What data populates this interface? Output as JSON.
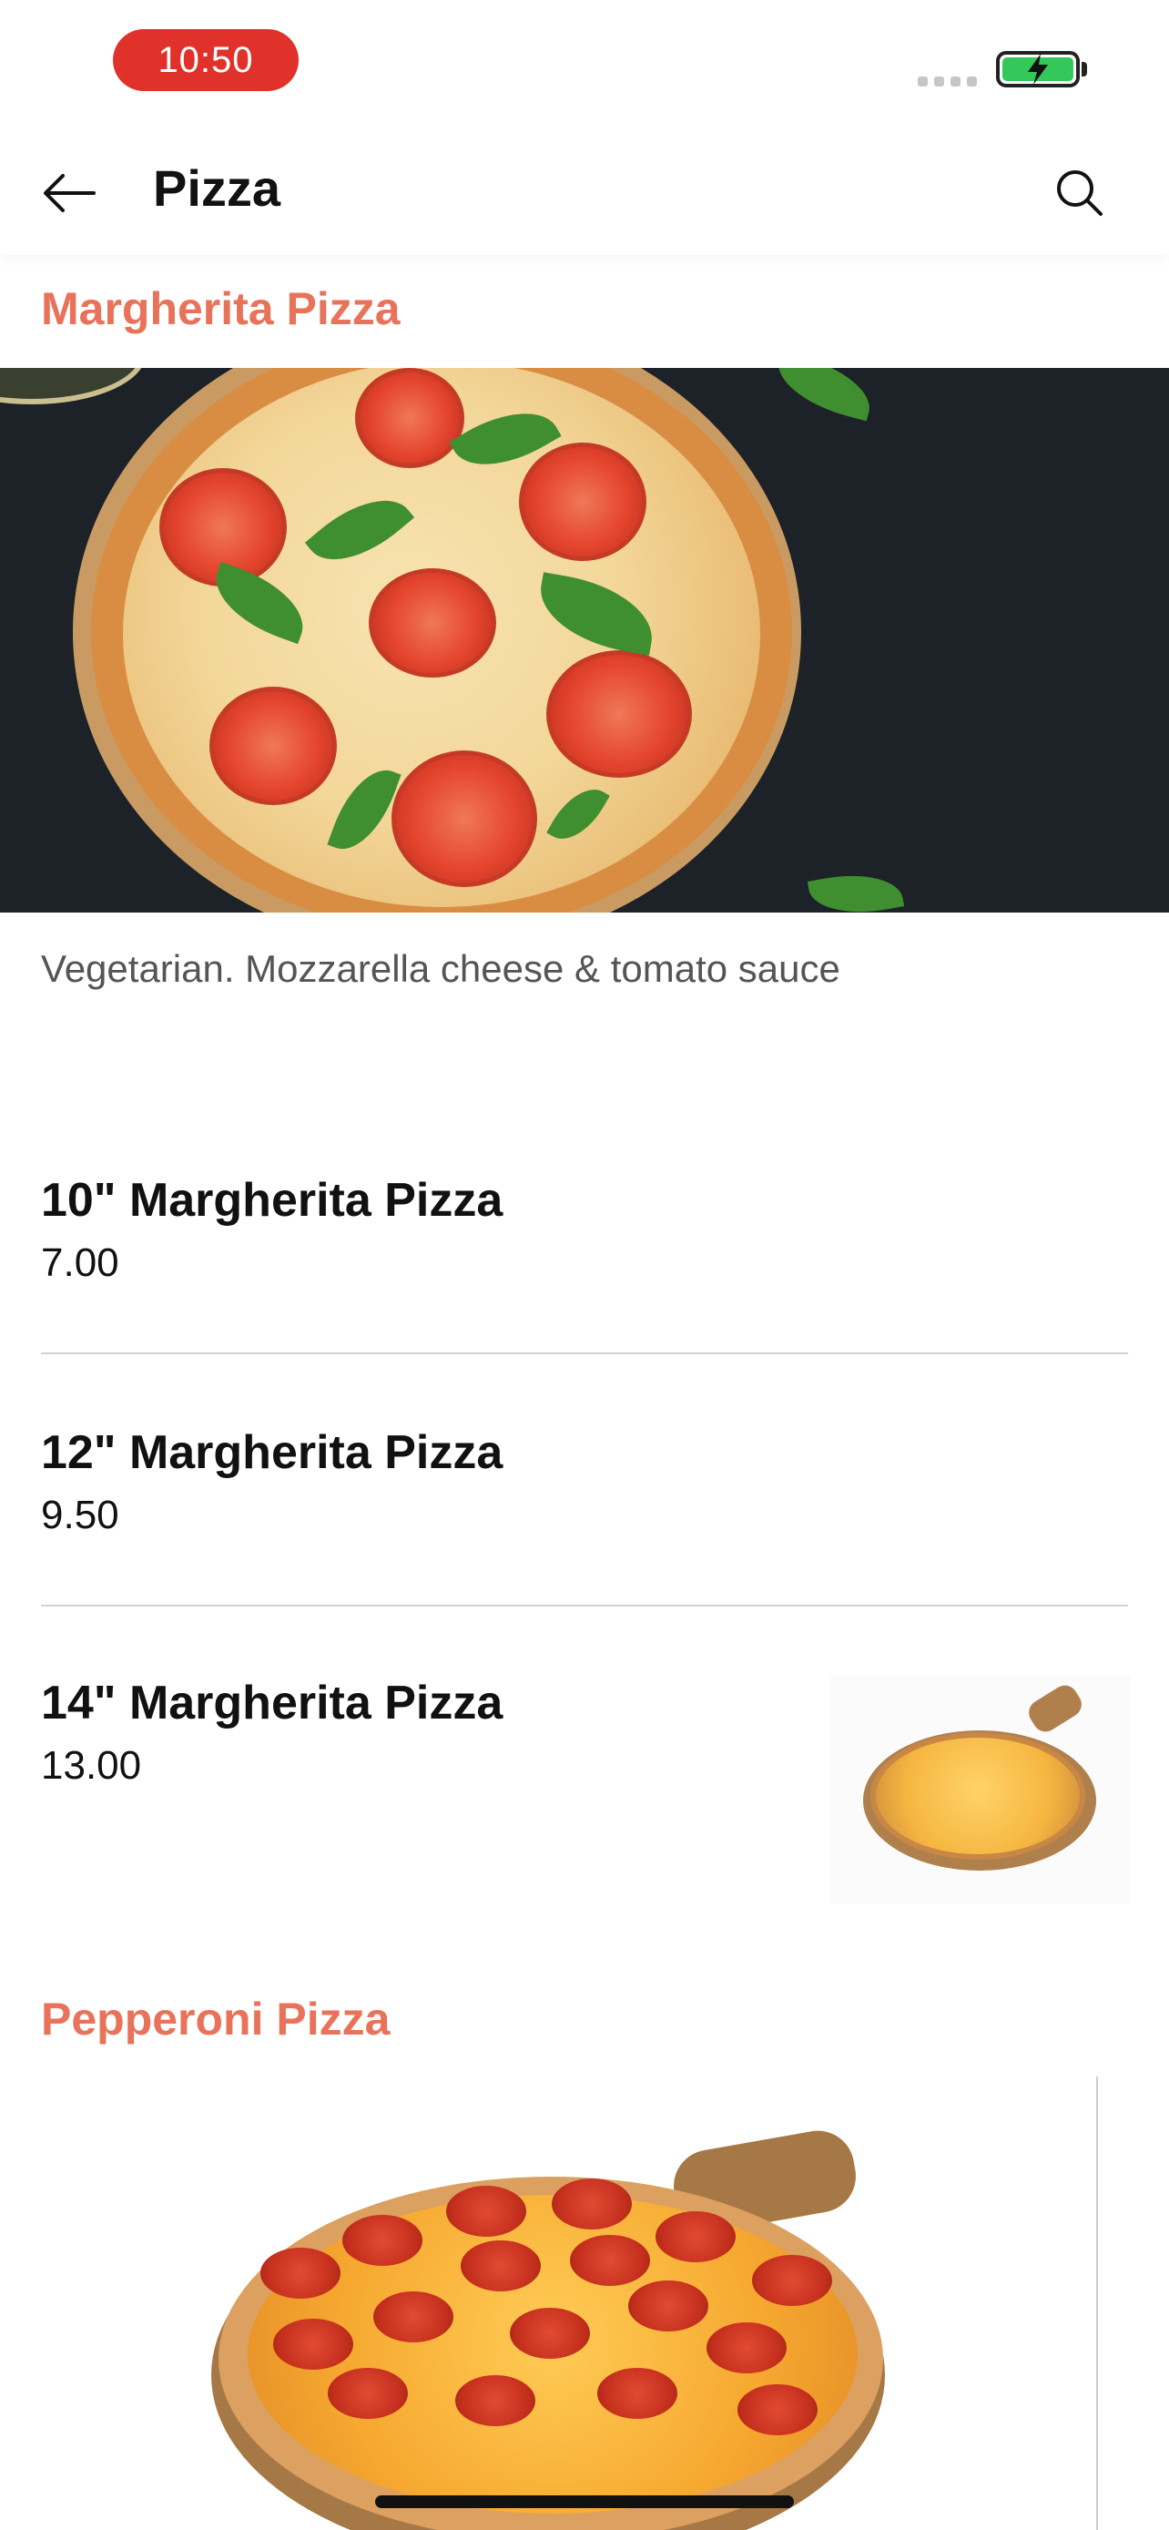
{
  "status_bar": {
    "time": "10:50",
    "battery_state": "charging",
    "colors": {
      "time_pill": "#e0322b",
      "battery": "#34c759"
    }
  },
  "nav": {
    "title": "Pizza",
    "back_icon": "arrow-left-icon",
    "search_icon": "search-icon"
  },
  "theme": {
    "accent": "#e8735a",
    "divider": "#d2d2d2"
  },
  "sections": [
    {
      "title": "Margherita Pizza",
      "description": "Vegetarian. Mozzarella cheese & tomato sauce",
      "items": [
        {
          "name": "10\" Margherita Pizza",
          "price": "7.00"
        },
        {
          "name": "12\" Margherita Pizza",
          "price": "9.50"
        },
        {
          "name": "14\" Margherita Pizza",
          "price": "13.00"
        }
      ]
    },
    {
      "title": "Pepperoni Pizza"
    }
  ]
}
